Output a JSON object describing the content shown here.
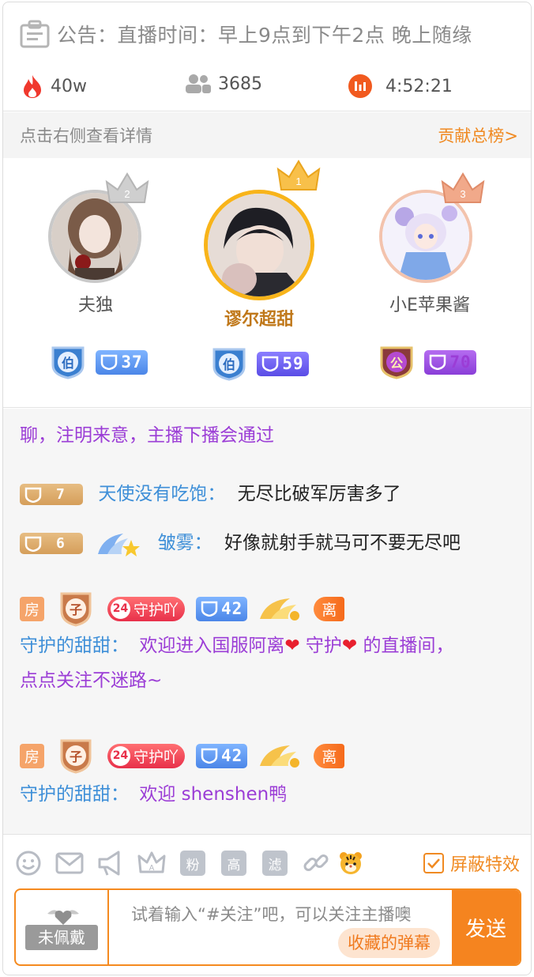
{
  "notice": {
    "label": "公告：",
    "text": "直播时间：早上9点到下午2点 晚上随缘"
  },
  "stats": {
    "heat": "40w",
    "viewers": "3685",
    "duration": "4:52:21"
  },
  "rank": {
    "tip": "点击右侧查看详情",
    "link": "贡献总榜>"
  },
  "top3": [
    {
      "rank": "2",
      "name": "夫独",
      "badge_char": "伯",
      "level": "37"
    },
    {
      "rank": "1",
      "name": "谬尔超甜",
      "badge_char": "伯",
      "level": "59"
    },
    {
      "rank": "3",
      "name": "小E苹果酱",
      "badge_char": "公",
      "level": "70"
    }
  ],
  "chat": {
    "system_tail": "聊，注明来意，主播下播会通过",
    "msg1": {
      "level": "7",
      "name": "天使没有吃饱：",
      "text": "无尽比破军厉害多了"
    },
    "msg2": {
      "level": "6",
      "name": "皱雾：",
      "text": "好像就射手就马可不要无尽吧"
    },
    "guard1": {
      "room": "房",
      "title_char": "子",
      "guard_num": "24",
      "guard_label": "守护吖",
      "level": "42",
      "pill": "离",
      "name": "守护的甜甜：",
      "line1_a": "欢迎进入国服阿离",
      "line1_b": "守护",
      "line1_c": "的直播间，",
      "line2": "点点关注不迷路~"
    },
    "guard2": {
      "room": "房",
      "title_char": "子",
      "guard_num": "24",
      "guard_label": "守护吖",
      "level": "42",
      "pill": "离",
      "name": "守护的甜甜：",
      "text": "欢迎 shenshen鸭"
    }
  },
  "toolbar": {
    "fans": "粉",
    "high": "高",
    "filter": "滤",
    "shield_effects": "屏蔽特效"
  },
  "input": {
    "medal": "未佩戴",
    "placeholder": "试着输入“#关注”吧，可以关注主播噢",
    "favorites": "收藏的弹幕",
    "send": "发送"
  },
  "colors": {
    "accent": "#f58a1f",
    "purple_text": "#9b3dd6",
    "name_blue": "#3e8fd8"
  }
}
